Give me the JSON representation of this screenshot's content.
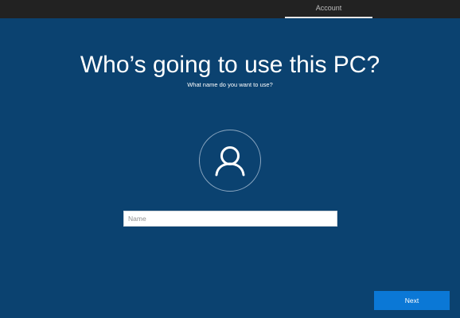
{
  "topbar": {
    "tab_label": "Account"
  },
  "main": {
    "title": "Who’s going to use this PC?",
    "subtitle": "What name do you want to use?",
    "avatar_icon": "person-icon",
    "name_input": {
      "placeholder": "Name",
      "value": ""
    }
  },
  "footer": {
    "next_label": "Next"
  },
  "colors": {
    "background": "#0b4270",
    "topbar": "#222222",
    "accent_button": "#0b78d6"
  }
}
